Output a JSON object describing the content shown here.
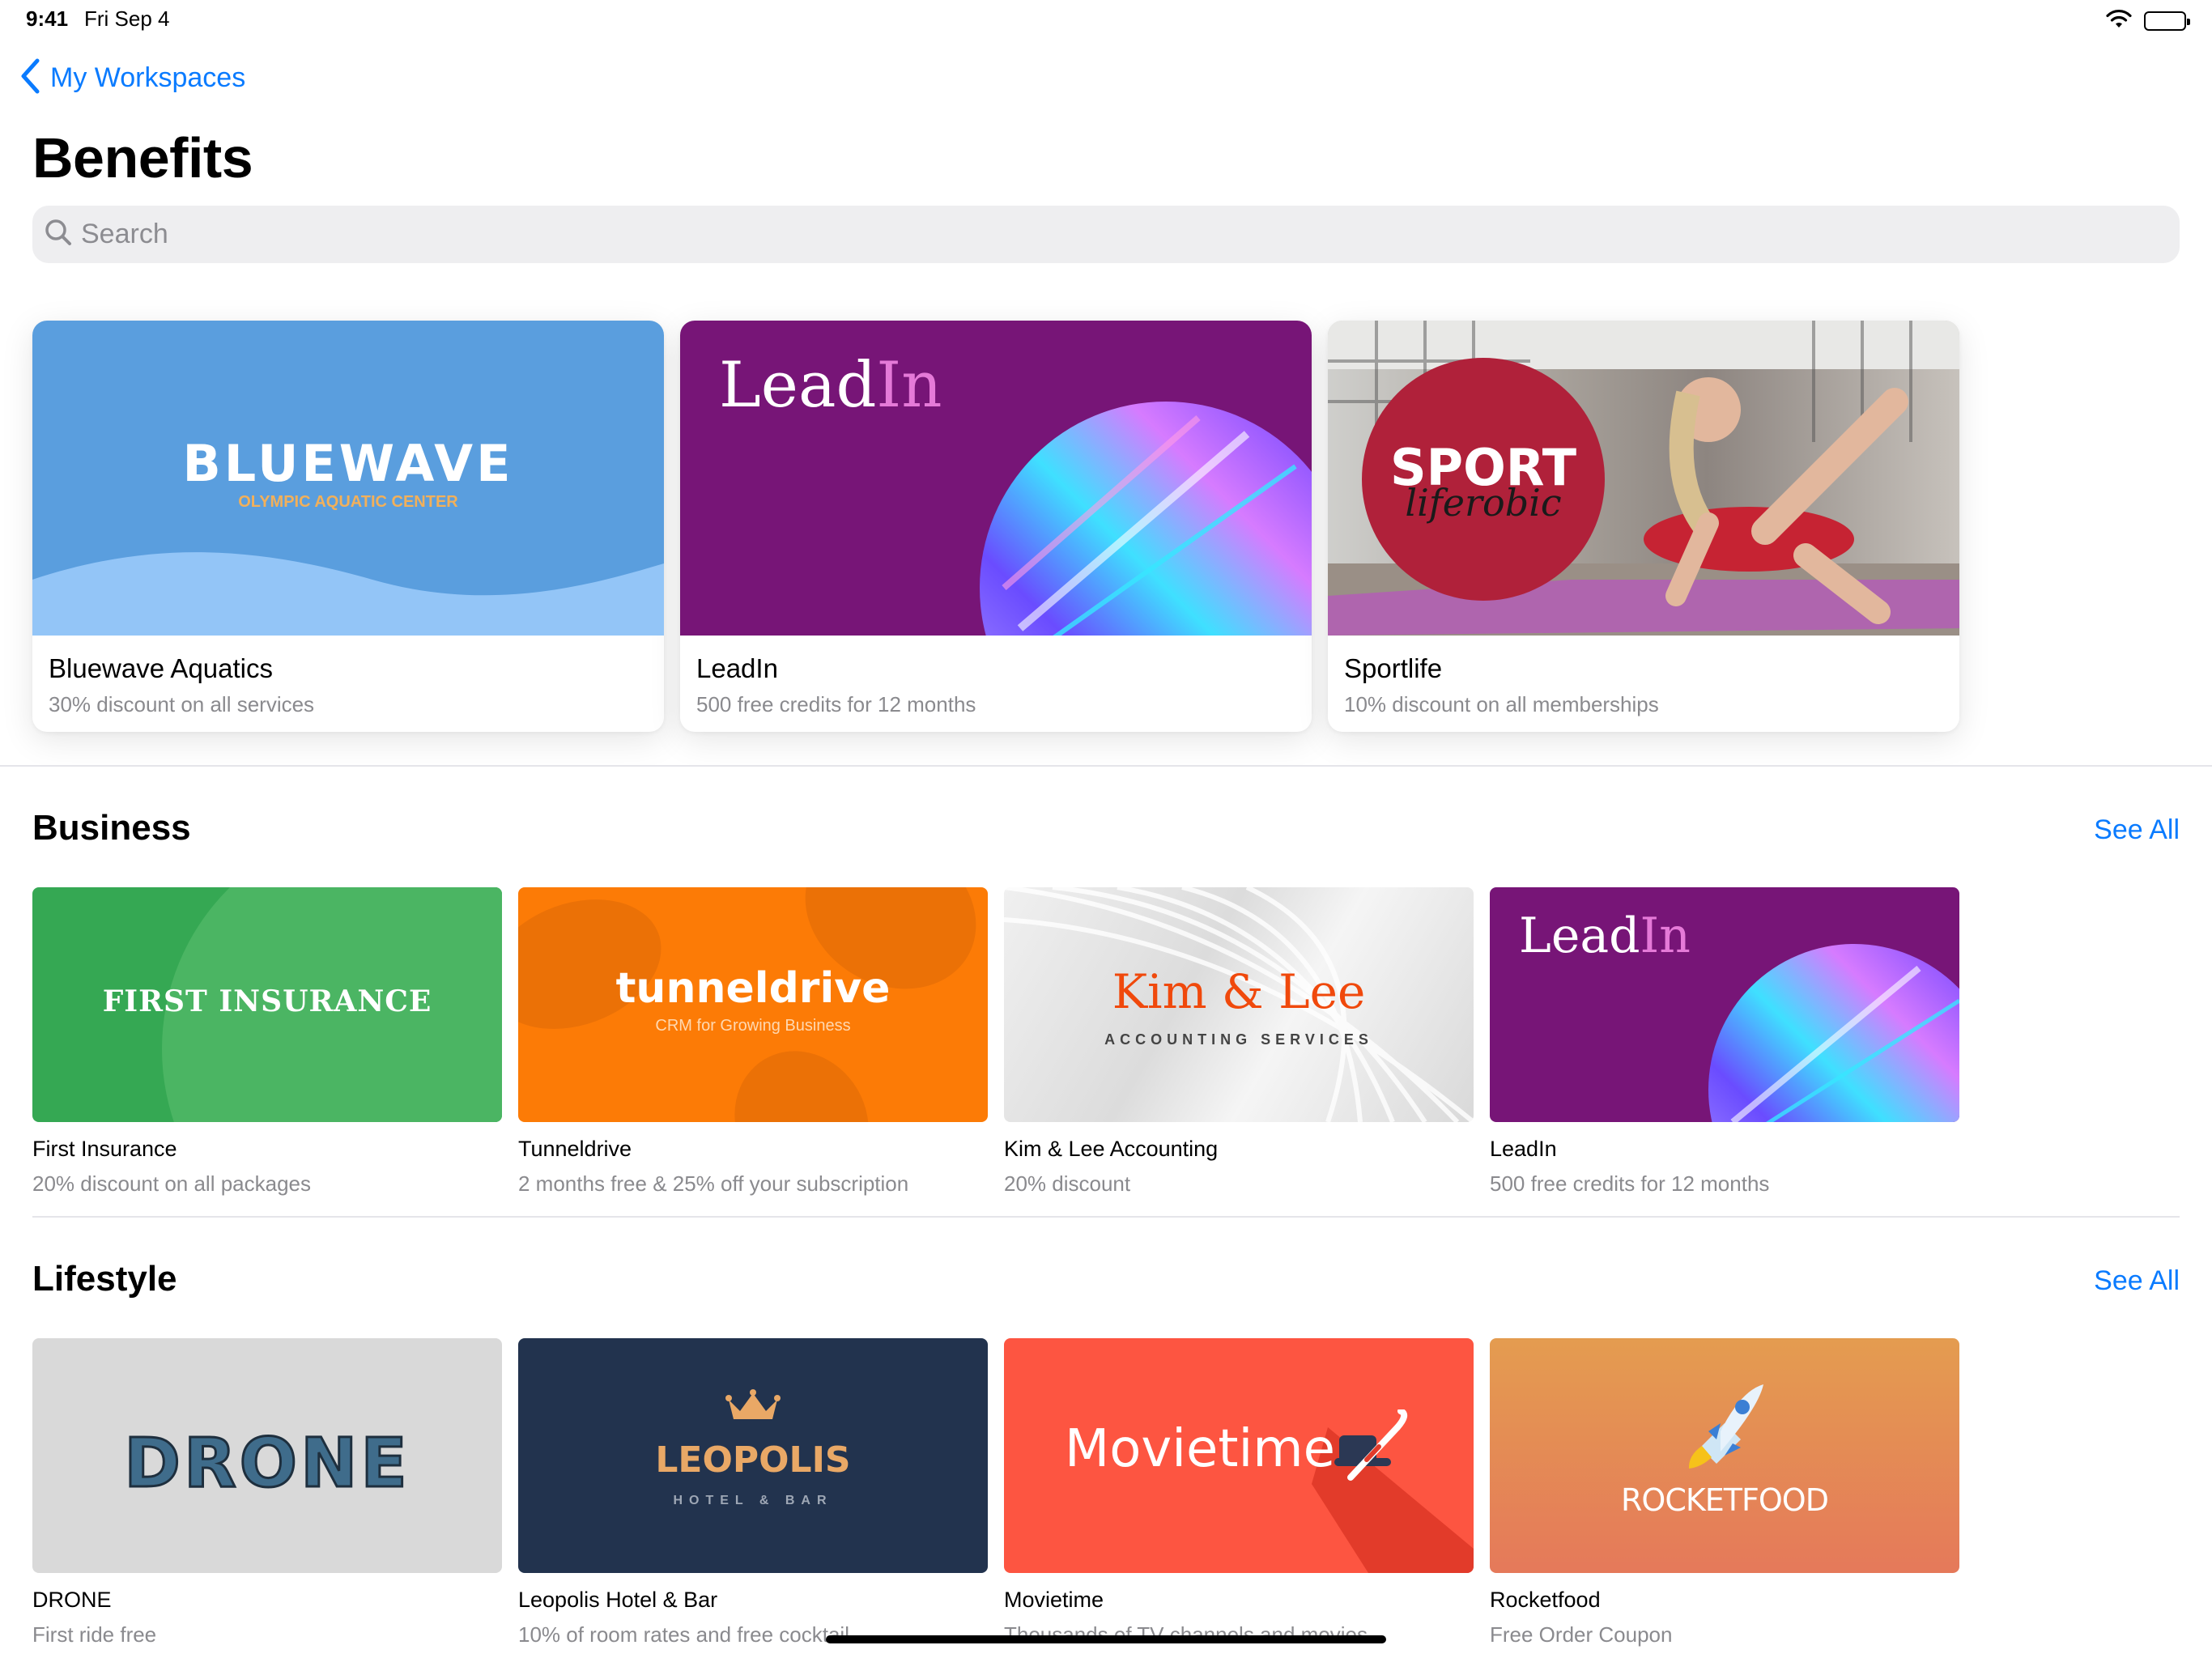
{
  "status": {
    "time": "9:41",
    "date": "Fri Sep 4"
  },
  "nav": {
    "back_label": "My Workspaces",
    "title": "Benefits"
  },
  "search": {
    "placeholder": "Search"
  },
  "featured": [
    {
      "title": "Bluewave Aquatics",
      "subtitle": "30% discount on all services",
      "logo": "BLUEWAVE",
      "logo_sub": "OLYMPIC AQUATIC CENTER"
    },
    {
      "title": "LeadIn",
      "subtitle": "500 free credits for 12 months",
      "logo_a": "Lead",
      "logo_b": "In"
    },
    {
      "title": "Sportlife",
      "subtitle": "10% discount on all memberships",
      "logo": "SPORT",
      "logo_script": "liferobic"
    }
  ],
  "business": {
    "title": "Business",
    "see_all": "See All",
    "items": [
      {
        "title": "First Insurance",
        "subtitle": "20% discount on all packages",
        "logo": "FIRST INSURANCE"
      },
      {
        "title": "Tunneldrive",
        "subtitle": "2 months free & 25% off your subscription",
        "logo": "tunneldrive",
        "logo_sub": "CRM for Growing Business"
      },
      {
        "title": "Kim & Lee Accounting",
        "subtitle": "20% discount",
        "logo": "Kim & Lee",
        "logo_sub": "ACCOUNTING SERVICES"
      },
      {
        "title": "LeadIn",
        "subtitle": "500 free credits for 12 months",
        "logo_a": "Lead",
        "logo_b": "In"
      }
    ]
  },
  "lifestyle": {
    "title": "Lifestyle",
    "see_all": "See All",
    "items": [
      {
        "title": "DRONE",
        "subtitle": "First ride free",
        "logo": "DRONE"
      },
      {
        "title": "Leopolis Hotel & Bar",
        "subtitle": "10% of room rates and free cocktail",
        "logo": "LEOPOLIS",
        "logo_sub": "HOTEL & BAR"
      },
      {
        "title": "Movietime",
        "subtitle": "Thousands of TV channels and movies",
        "logo": "Movietime"
      },
      {
        "title": "Rocketfood",
        "subtitle": "Free Order Coupon",
        "logo": "ROCKETFOOD"
      }
    ]
  }
}
